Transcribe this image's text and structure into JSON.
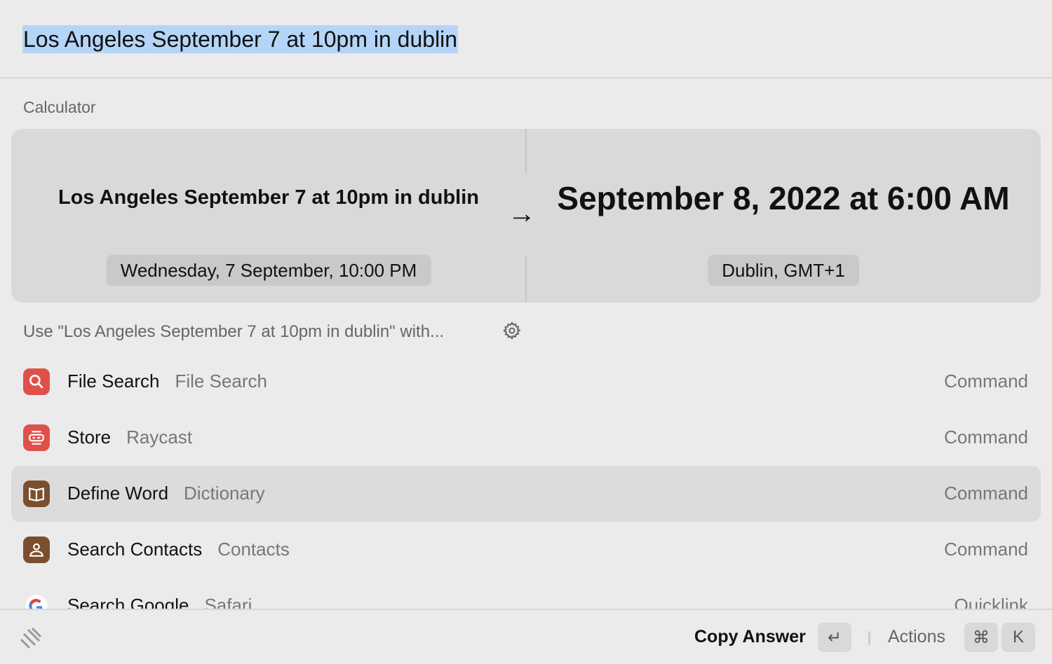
{
  "search": {
    "query": "Los Angeles September 7 at 10pm in dublin"
  },
  "calculator": {
    "section_label": "Calculator",
    "question": "Los Angeles September 7 at 10pm in dublin",
    "question_detail": "Wednesday, 7 September, 10:00 PM",
    "answer": "September 8, 2022 at 6:00 AM",
    "answer_detail": "Dublin, GMT+1",
    "arrow": "→"
  },
  "fallback": {
    "label": "Use \"Los Angeles September 7 at 10pm in dublin\" with..."
  },
  "items": [
    {
      "title": "File Search",
      "subtitle": "File Search",
      "kind": "Command",
      "icon": "magnifier-icon",
      "color": "#e0504a"
    },
    {
      "title": "Store",
      "subtitle": "Raycast",
      "kind": "Command",
      "icon": "store-icon",
      "color": "#e0504a"
    },
    {
      "title": "Define Word",
      "subtitle": "Dictionary",
      "kind": "Command",
      "icon": "book-icon",
      "color": "#7b4f2e",
      "selected": true
    },
    {
      "title": "Search Contacts",
      "subtitle": "Contacts",
      "kind": "Command",
      "icon": "person-icon",
      "color": "#7b4f2e"
    },
    {
      "title": "Search Google",
      "subtitle": "Safari",
      "kind": "Quicklink",
      "icon": "google-icon"
    }
  ],
  "footer": {
    "primary_action": "Copy Answer",
    "enter_key": "↵",
    "actions_label": "Actions",
    "cmd_key": "⌘",
    "k_key": "K"
  }
}
